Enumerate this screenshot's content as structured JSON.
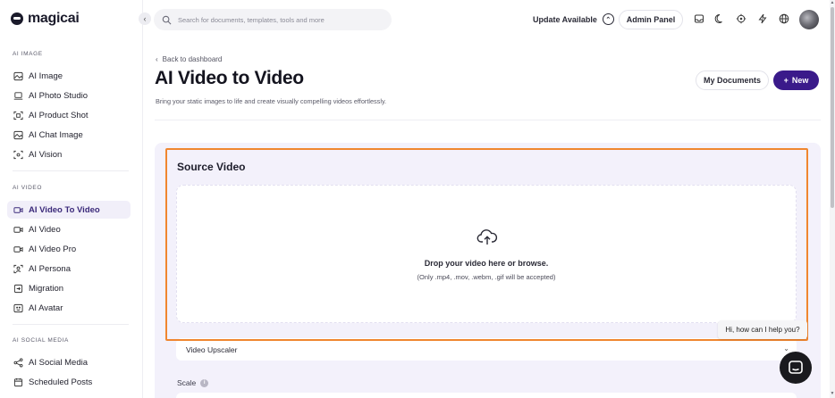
{
  "sidebar": {
    "brand": "magicai",
    "sections": {
      "ai_image": "AI IMAGE",
      "ai_video": "AI VIDEO",
      "ai_social": "AI SOCIAL MEDIA"
    },
    "image_items": [
      {
        "label": "AI Image",
        "icon": "image-icon"
      },
      {
        "label": "AI Photo Studio",
        "icon": "laptop-icon"
      },
      {
        "label": "AI Product Shot",
        "icon": "product-shot-icon"
      },
      {
        "label": "AI Chat Image",
        "icon": "image-icon"
      },
      {
        "label": "AI Vision",
        "icon": "vision-icon"
      }
    ],
    "video_items": [
      {
        "label": "AI Video To Video",
        "icon": "video-camera-icon",
        "active": true
      },
      {
        "label": "AI Video",
        "icon": "video-camera-icon"
      },
      {
        "label": "AI Video Pro",
        "icon": "video-camera-icon"
      },
      {
        "label": "AI Persona",
        "icon": "persona-icon"
      },
      {
        "label": "Migration",
        "icon": "migration-icon"
      },
      {
        "label": "AI Avatar",
        "icon": "avatar-icon"
      }
    ],
    "social_items": [
      {
        "label": "AI Social Media",
        "icon": "share-icon"
      },
      {
        "label": "Scheduled Posts",
        "icon": "calendar-icon"
      }
    ]
  },
  "topbar": {
    "search_placeholder": "Search for documents, templates, tools and more",
    "update_label": "Update Available",
    "admin_label": "Admin Panel"
  },
  "header": {
    "back_label": "Back to dashboard",
    "title": "AI Video to Video",
    "subtitle": "Bring your static images to life and create visually compelling videos effortlessly.",
    "my_documents_label": "My Documents",
    "new_label": "New"
  },
  "form": {
    "section_title": "Source Video",
    "drop_main": "Drop your video here or browse.",
    "drop_hint": "(Only .mp4, .mov, .webm, .gif will be accepted)",
    "model_selected": "Video Upscaler",
    "scale_label": "Scale"
  },
  "chat": {
    "bubble_text": "Hi, how can I help you?"
  },
  "colors": {
    "accent": "#3a1a8a",
    "highlight": "#f0862f",
    "panel": "#f3f1fb"
  }
}
